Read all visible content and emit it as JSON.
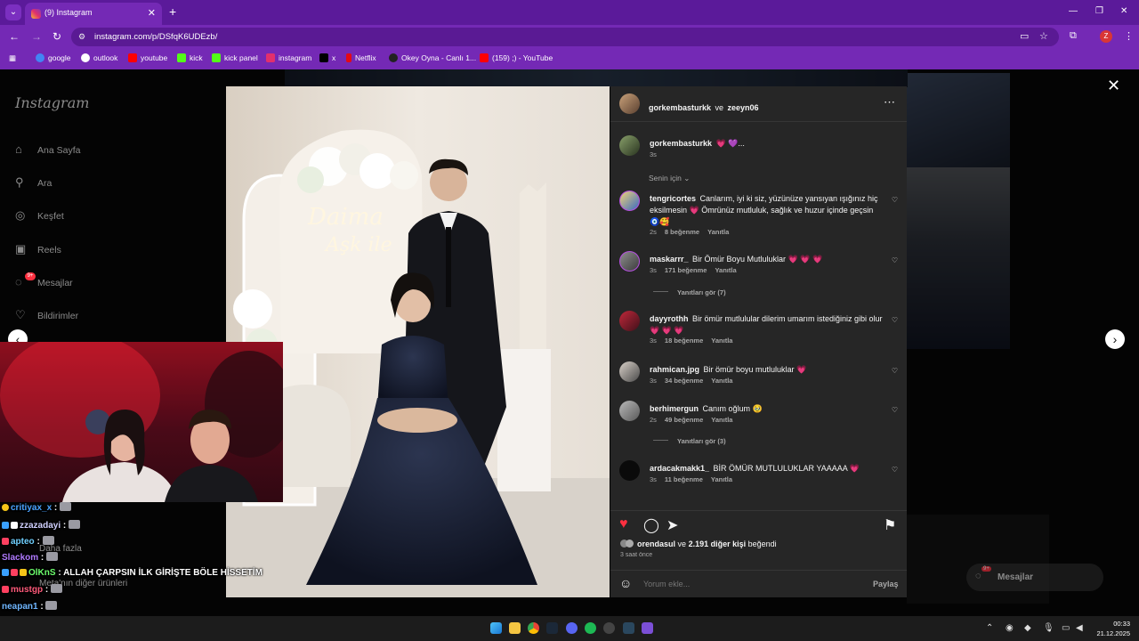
{
  "browser": {
    "tab_title": "(9) Instagram",
    "url": "instagram.com/p/DSfqK6UDEzb/",
    "profile_initial": "Z",
    "bookmarks": [
      {
        "label": "google",
        "color": "#4285f4"
      },
      {
        "label": "outlook",
        "color": "#ffffff"
      },
      {
        "label": "youtube",
        "color": "#ff0000"
      },
      {
        "label": "kick",
        "color": "#53fc18"
      },
      {
        "label": "kick panel",
        "color": "#53fc18"
      },
      {
        "label": "instagram",
        "color": "#e1306c"
      },
      {
        "label": "x",
        "color": "#000000"
      },
      {
        "label": "Netflix",
        "color": "#e50914"
      },
      {
        "label": "Okey Oyna - Canlı 1...",
        "color": "#222222"
      },
      {
        "label": "(159) ;) - YouTube",
        "color": "#ff0000"
      }
    ]
  },
  "sidebar": {
    "logo": "Instagram",
    "items": [
      {
        "label": "Ana Sayfa",
        "icon": "home-icon"
      },
      {
        "label": "Ara",
        "icon": "search-icon"
      },
      {
        "label": "Keşfet",
        "icon": "compass-icon"
      },
      {
        "label": "Reels",
        "icon": "reels-icon"
      },
      {
        "label": "Mesajlar",
        "icon": "messenger-icon"
      },
      {
        "label": "Bildirimler",
        "icon": "heart-icon"
      }
    ],
    "messages_badge": "9+",
    "bottom_items": [
      "Daha fazla",
      "Meta'nın diğer ürünleri"
    ]
  },
  "post": {
    "header": {
      "user1": "gorkembasturkk",
      "connector": "ve",
      "user2": "zeeyn06"
    },
    "caption": {
      "user": "gorkembasturkk",
      "text": "💗 💜...",
      "time": "3s"
    },
    "sort_label": "Senin için",
    "comments": [
      {
        "user": "tengricortes",
        "text": "Canlarım, iyi ki siz, yüzünüze yansıyan ışığınız hiç eksilmesin 💗 Ömrünüz mutluluk, sağlık ve huzur içinde geçsin 🧿🥰",
        "time": "2s",
        "likes": "8 beğenme",
        "reply": "Yanıtla"
      },
      {
        "user": "maskarrr_",
        "text": "Bir Ömür Boyu Mutluluklar 💗 💗 💗",
        "time": "3s",
        "likes": "171 beğenme",
        "reply": "Yanıtla",
        "view_replies": "Yanıtları gör (7)"
      },
      {
        "user": "dayyrothh",
        "text": "Bir ömür mutlulular dilerim umarım istediğiniz gibi olur 💗 💗 💗",
        "time": "3s",
        "likes": "18 beğenme",
        "reply": "Yanıtla"
      },
      {
        "user": "rahmican.jpg",
        "text": "Bir ömür boyu mutluluklar 💗",
        "time": "3s",
        "likes": "34 beğenme",
        "reply": "Yanıtla"
      },
      {
        "user": "berhimergun",
        "text": "Canım oğlum 🥹",
        "time": "2s",
        "likes": "49 beğenme",
        "reply": "Yanıtla",
        "view_replies": "Yanıtları gör (3)"
      },
      {
        "user": "ardacakmakk1_",
        "text": "BİR ÖMÜR MUTLULUKLAR YAAAAA 💗",
        "time": "3s",
        "likes": "11 beğenme",
        "reply": "Yanıtla"
      }
    ],
    "liked_by": {
      "user": "orendasul",
      "connector": "ve",
      "rest": "2.191 diğer kişi",
      "suffix": "beğendi"
    },
    "posted_ago": "3 saat önce",
    "comment_placeholder": "Yorum ekle...",
    "post_button": "Paylaş"
  },
  "photo_sign": {
    "line1": "Daima",
    "line2": "Aşk ile"
  },
  "chat": [
    {
      "user": "critiyax_x",
      "color": "#4aa3ff",
      "msg": " : ",
      "emote": true
    },
    {
      "user": "zzazadayi",
      "color": "#d0d0ff",
      "msg": " : ",
      "emote": true
    },
    {
      "user": "apteo",
      "color": "#6fd0ff",
      "msg": " : ",
      "emote": true
    },
    {
      "user": "Slackom",
      "color": "#b07aff",
      "msg": " : ",
      "emote": true
    },
    {
      "user": "OlKnS",
      "color": "#6dff6d",
      "msg": " : ALLAH ÇARPSIN İLK GİRİŞTE BÖLE HİSSETİM",
      "emote": false
    },
    {
      "user": "mustgp",
      "color": "#ff5a7a",
      "msg": " : ",
      "emote": true
    },
    {
      "user": "neapan1",
      "color": "#6fb6ff",
      "msg": " : ",
      "emote": true
    }
  ],
  "right_widget": {
    "label": "Mesajlar",
    "badge": "9+"
  },
  "taskbar": {
    "time": "00:33",
    "date": "21.12.2025"
  }
}
